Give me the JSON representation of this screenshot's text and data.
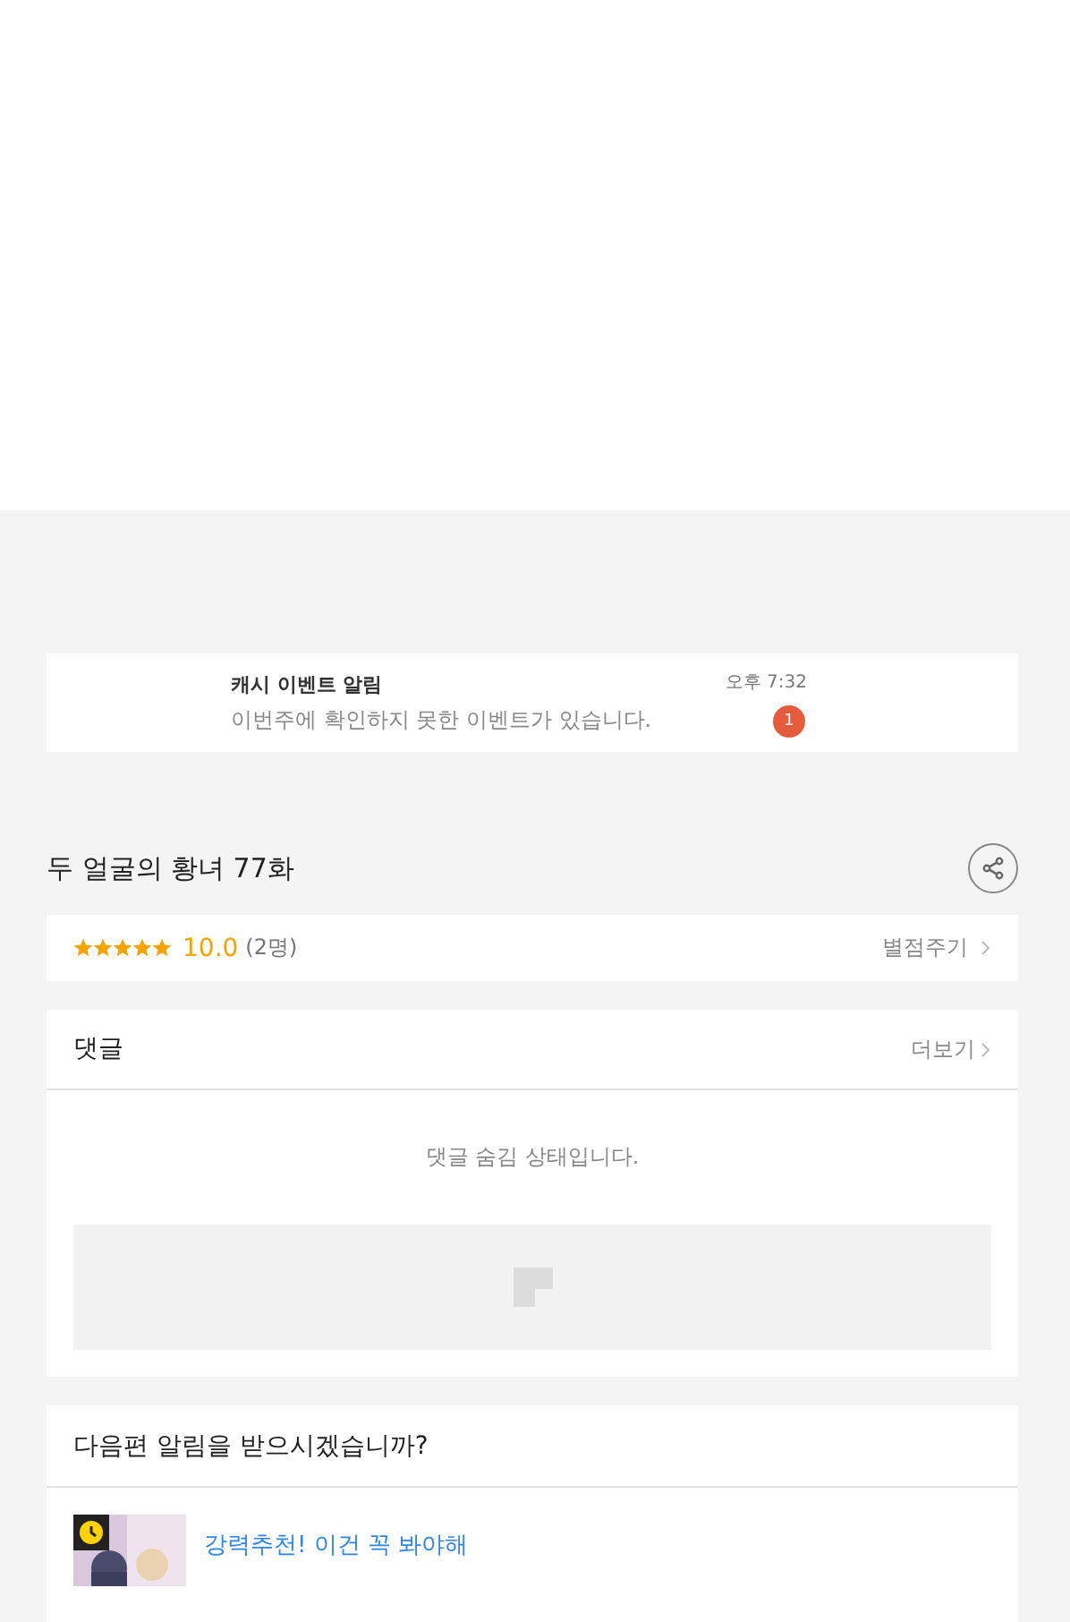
{
  "notification": {
    "title": "캐시 이벤트 알림",
    "message": "이번주에 확인하지 못한 이벤트가 있습니다.",
    "time": "오후 7:32",
    "badge": "1"
  },
  "episode": {
    "title": "두 얼굴의 황녀 77화"
  },
  "rating": {
    "stars": 5,
    "score": "10.0",
    "count": "(2명)",
    "action": "별점주기"
  },
  "comments": {
    "title": "댓글",
    "more": "더보기",
    "message": "댓글 숨김 상태입니다."
  },
  "next_alert": {
    "title": "다음편 알림을 받으시겠습니까?",
    "recommendation": {
      "kind": "picture",
      "title": "강력추천! 이건 꼭 봐야해"
    }
  }
}
